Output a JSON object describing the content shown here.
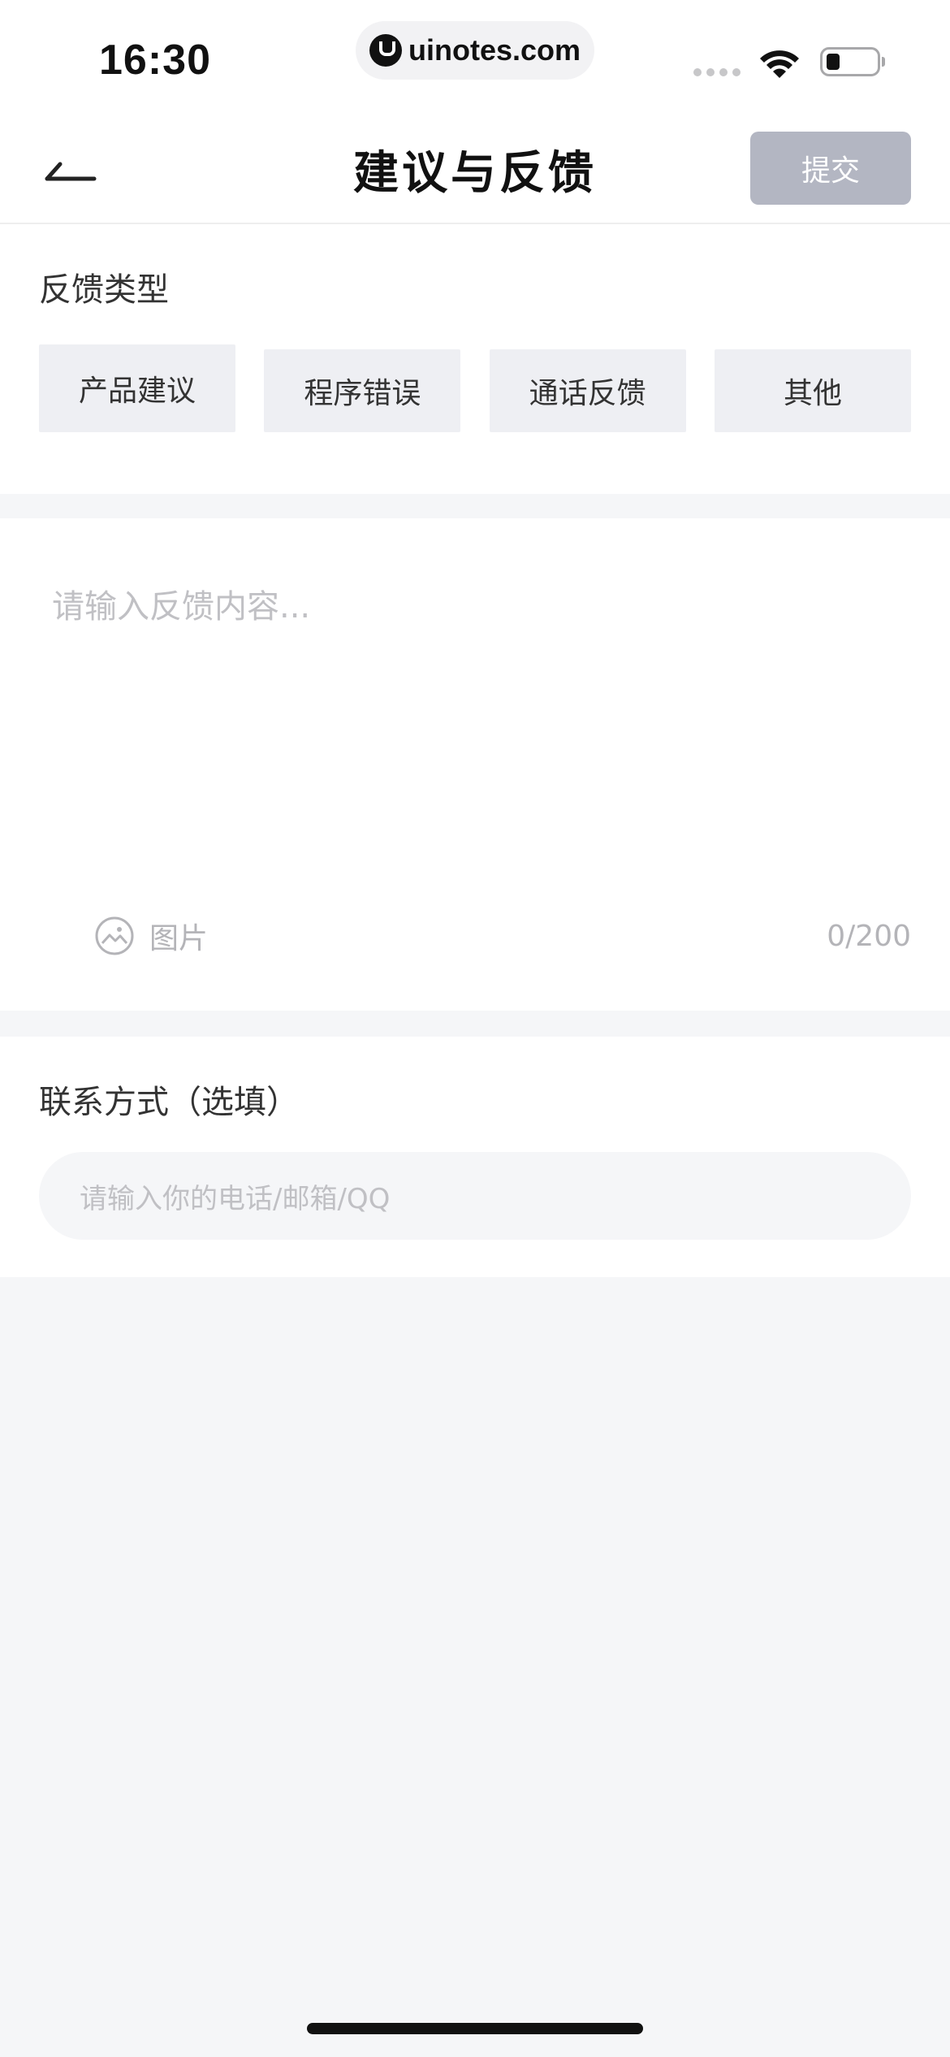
{
  "status_bar": {
    "time": "16:30",
    "url": "uinotes.com"
  },
  "nav": {
    "title": "建议与反馈",
    "submit_label": "提交"
  },
  "feedback_type": {
    "label": "反馈类型",
    "options": [
      "产品建议",
      "程序错误",
      "通话反馈",
      "其他"
    ]
  },
  "feedback_content": {
    "placeholder": "请输入反馈内容...",
    "image_label": "图片",
    "count": "0/200"
  },
  "contact": {
    "label": "联系方式（选填）",
    "placeholder": "请输入你的电话/邮箱/QQ"
  },
  "colors": {
    "submit_disabled": "#b3b6c2",
    "chip_bg": "#eeeff3",
    "page_bg": "#f5f6f8",
    "placeholder": "#c0c0c4"
  },
  "icons": {
    "back": "arrow-left-icon",
    "image": "image-icon",
    "wifi": "wifi-icon",
    "battery": "battery-icon"
  }
}
